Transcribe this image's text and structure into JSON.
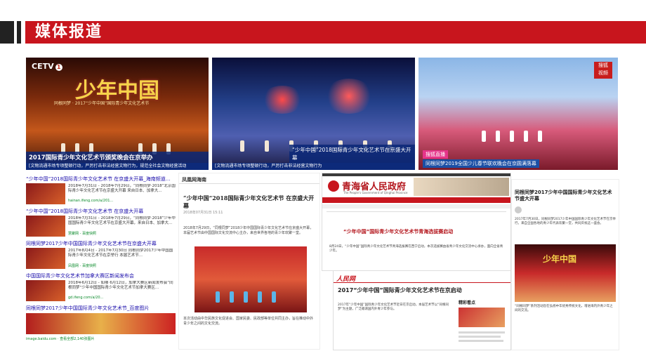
{
  "header": {
    "title": "媒体报道",
    "accent_color": "#c8151d"
  },
  "screens": {
    "cctv": {
      "logo": "CETV",
      "logo_num": "1",
      "headline_art": "少年中国",
      "sub_art": "同根同梦 · 2017“少年中国”国际青少年文化艺术节",
      "caption": "2017国际青少年文化艺术节颁奖晚会在京举办",
      "ticker": "[文物流通市场专项整顿行动，严厉打击非法经营文物行为，规范全社会文物经营活动"
    },
    "stage": {
      "caption": "“少年中国”2018国际青少年文化艺术节在京盛大开幕",
      "ticker": "[文物流通市场专项整顿行动，严厉打击非法经营文物行为"
    },
    "gala": {
      "logo_top": "搜狐",
      "logo_bottom": "视频",
      "caption": "同根同梦2019全国少儿春节联欢晚会在京圆满落幕",
      "badge": "搜狐直播"
    }
  },
  "search": {
    "results": [
      {
        "title": "“少年中国”2018国际青少年文化艺术节 在京盛大开幕_海南频道...",
        "snippet": "2018年7月31日 - 2018年7月29日，“同根同梦·2018”北京国际青少年文化艺术节在京盛大开幕 来自日本、加拿大...",
        "url": "hainan.ifeng.com/a/201..."
      },
      {
        "title": "“少年中国”2018国际青少年文化艺术节 在京盛大开幕",
        "snippet": "2018年7月31日 - 2018年7月29日，“同根同梦·2018”少年中国国际青少年文化艺术节在京盛大开幕，来自日本、加拿大...",
        "url": "慧聚网 - 百度快照"
      },
      {
        "title": "同根同梦2017少年中国国际青少年文化艺术节在京盛大开幕",
        "snippet": "2017年8月4日 - 2017年7月30日 同根同梦2017少年中国国际青少年文化艺术节在京举行 本届艺术节...",
        "url": "凤凰网 - 百度快照"
      },
      {
        "title": "中国国际青少年文化艺术节加拿大赛区新闻发布会",
        "snippet": "2018年6月12日 - 如哪 6月12日，加拿大赛区新闻发布会“同根同梦”少年中国国际青少年文化艺术节加拿大赛区...",
        "url": "gd.ifeng.com/a/20..."
      },
      {
        "title": "同根同梦2017少年中国国际青少年文化艺术节_百度图片",
        "snippet": "",
        "url": "image.baidu.com · 查看全部2,140张图片"
      }
    ]
  },
  "article": {
    "site": "凤凰网海南",
    "title": "“少年中国”2018国际青少年文化艺术节 在京盛大开幕",
    "date": "2018年07月31日 15:11",
    "body": "2018年7月29日，“同根同梦”2018少年中国国际青少年文化艺术节在京盛大开幕，本届艺术节由中国国际文化交流中心主办，来自世界各地的青少年欢聚一堂。",
    "footer": "本次活动由中华民族文化促进会、国家民委、民政部等单位共同主办，旨在推动中外青少年之间的文化交流。"
  },
  "gov": {
    "site_title": "青海省人民政府",
    "site_sub": "The People's Government of Qinghai Province",
    "headline": "“少年中国”国际青少年文化艺术节青海选拔赛启动",
    "body": "8月24日，“少年中国”国际青少年文化艺术节青海选拔赛在西宁启动，本次选拔赛由省青少年文化交流中心承办，面向全省青少年。"
  },
  "people": {
    "logo": "人民网",
    "headline": "2017“少年中国”国际青少年文化艺术节在京启动",
    "side_title": "精彩看点",
    "body": "2017年“少年中国”国际青少年文化艺术节近日在京启动，本届艺术节以“同根同梦”为主题，广泛邀请国内外青少年参与。"
  },
  "mobile": {
    "title": "同根同梦2017少年中国国际青少年文化艺术节盛大开幕",
    "body": "2017年7月30日，同根同梦2017少年中国国际青少年文化艺术节在京举行，来自全国各地的青少年代表欢聚一堂，共同庆祝这一盛会。",
    "body2": "“同根同梦”系列活动旨在弘扬中华优秀传统文化，增进海内外青少年之间的交流。"
  }
}
